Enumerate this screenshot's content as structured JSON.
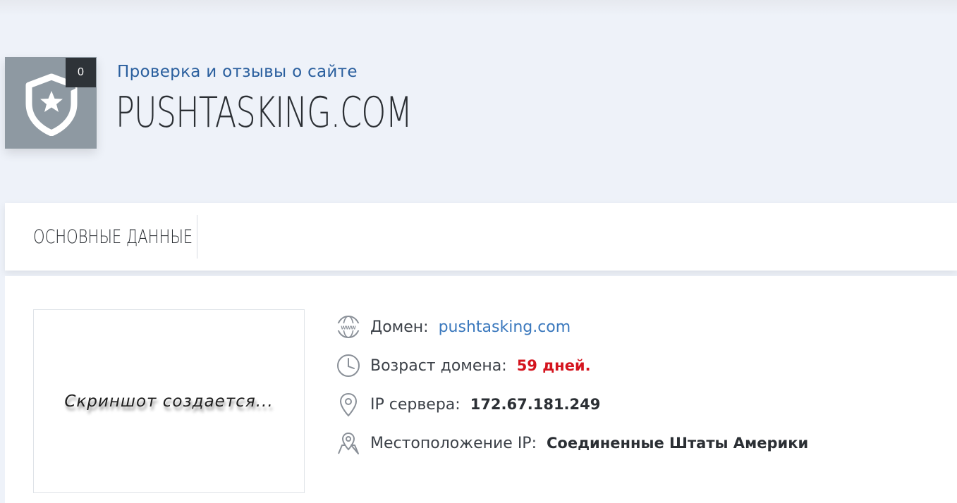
{
  "header": {
    "subtitle": "Проверка и отзывы о сайте",
    "domain": "PUSHTASKING.COM",
    "review_count": "0",
    "badge_icon": "shield-star-icon",
    "colors": {
      "badge_bg": "#8e99a2",
      "counter_bg": "#2e3338",
      "accent": "#2a5f9e"
    }
  },
  "tabs": [
    {
      "label": "ОСНОВНЫЕ ДАННЫЕ"
    }
  ],
  "screenshot": {
    "placeholder_text": "Скриншот создается..."
  },
  "info": {
    "domain": {
      "icon": "www-icon",
      "label": "Домен:",
      "value": "pushtasking.com",
      "color": "#3a78bd"
    },
    "age": {
      "icon": "clock-icon",
      "label": "Возраст домена:",
      "value": "59 дней.",
      "color": "#d4141e"
    },
    "ip": {
      "icon": "map-pin-icon",
      "label": "IP сервера:",
      "value": "172.67.181.249"
    },
    "location": {
      "icon": "map-location-icon",
      "label": "Местоположение IP:",
      "value": "Соединенные Штаты Америки"
    }
  }
}
